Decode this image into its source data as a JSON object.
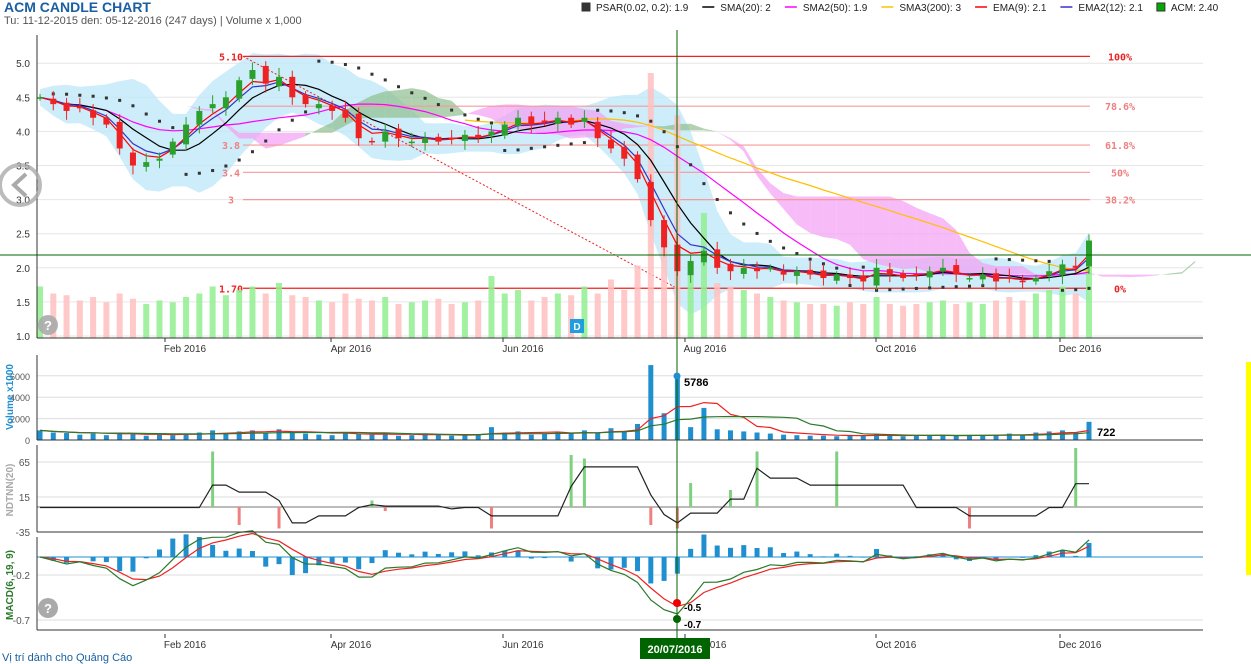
{
  "header": {
    "title": "ACM CANDLE CHART",
    "subtitle": "Tu: 11-12-2015 den: 05-12-2016 (247 days) | Volume x 1,000"
  },
  "legend": [
    {
      "label": "PSAR(0.02, 0.2): 1.9",
      "color": "#333333",
      "kind": "square"
    },
    {
      "label": "SMA(20): 2",
      "color": "#000000",
      "kind": "line"
    },
    {
      "label": "SMA2(50): 1.9",
      "color": "#ff00ff",
      "kind": "line"
    },
    {
      "label": "SMA3(200): 3",
      "color": "#ffc000",
      "kind": "line"
    },
    {
      "label": "EMA(9): 2.1",
      "color": "#ff0000",
      "kind": "line"
    },
    {
      "label": "EMA2(12): 2.1",
      "color": "#3333cc",
      "kind": "line"
    },
    {
      "label": "ACM: 2.40",
      "color": "#00aa00",
      "kind": "square"
    }
  ],
  "footer": "Vị trí dành cho Quảng Cáo",
  "crosshair": {
    "date": "20/07/2016",
    "volume_label": "5786",
    "macd_label": "-0.5",
    "signal_label": "-0.7",
    "vol_ma_label": "722"
  },
  "badge_d": "D",
  "colors": {
    "up": "#2ca02c",
    "down": "#ee2222",
    "vol_up": "#90ee90",
    "vol_down": "#ffc0c0",
    "volume": "#1f8fd0",
    "accent": "#1a5fa0"
  },
  "chart_data": {
    "type": "candlestick",
    "title": "ACM CANDLE CHART",
    "x_ticks": [
      "Feb 2016",
      "Apr 2016",
      "Jun 2016",
      "Aug 2016",
      "Oct 2016",
      "Dec 2016"
    ],
    "price_axis": {
      "ticks": [
        "1.0",
        "1.5",
        "2.0",
        "2.5",
        "3.0",
        "3.5",
        "4.0",
        "4.5",
        "5.0"
      ],
      "ylim": [
        1.0,
        5.4
      ]
    },
    "close": [
      4.5,
      4.4,
      4.3,
      4.35,
      4.2,
      4.1,
      3.75,
      3.5,
      3.55,
      3.6,
      3.85,
      4.1,
      4.3,
      4.4,
      4.5,
      4.75,
      4.9,
      4.7,
      4.8,
      4.5,
      4.4,
      4.4,
      4.3,
      4.2,
      3.9,
      3.85,
      4.0,
      3.9,
      3.85,
      3.9,
      3.85,
      3.9,
      3.95,
      3.9,
      4.0,
      4.1,
      4.2,
      4.1,
      4.15,
      4.2,
      4.1,
      4.2,
      3.9,
      3.75,
      3.6,
      3.3,
      2.7,
      2.3,
      1.95,
      2.1,
      2.25,
      2.0,
      1.95,
      2.0,
      1.95,
      2.0,
      1.9,
      1.95,
      1.9,
      1.85,
      1.9,
      1.85,
      1.8,
      2.0,
      1.9,
      1.85,
      1.9,
      1.95,
      2.0,
      1.9,
      1.85,
      1.9,
      1.8,
      1.85,
      1.8,
      1.85,
      1.95,
      2.05,
      2.0,
      2.4
    ],
    "volume": [
      900,
      700,
      650,
      500,
      600,
      450,
      700,
      550,
      400,
      500,
      450,
      600,
      700,
      900,
      650,
      800,
      900,
      700,
      1000,
      650,
      600,
      500,
      450,
      700,
      550,
      500,
      600,
      400,
      450,
      500,
      550,
      400,
      450,
      500,
      1200,
      700,
      800,
      500,
      600,
      700,
      650,
      900,
      700,
      1100,
      800,
      1500,
      7000,
      2500,
      5786,
      1200,
      3000,
      1000,
      900,
      800,
      700,
      600,
      500,
      450,
      400,
      400,
      350,
      450,
      400,
      600,
      400,
      350,
      400,
      450,
      500,
      400,
      450,
      400,
      500,
      600,
      500,
      700,
      800,
      900,
      700,
      1700
    ],
    "fibonacci": [
      {
        "label": "100%",
        "price": 5.1,
        "left_label": "5.10"
      },
      {
        "label": "78.6%",
        "price": 4.37,
        "left_label": ""
      },
      {
        "label": "61.8%",
        "price": 3.8,
        "left_label": "3.8"
      },
      {
        "label": "50%",
        "price": 3.4,
        "left_label": "3.4"
      },
      {
        "label": "38.2%",
        "price": 3.0,
        "left_label": "3"
      },
      {
        "label": "0%",
        "price": 1.7,
        "left_label": "1.70"
      }
    ],
    "volume_panel": {
      "label": "Volume x1000",
      "ticks": [
        "0",
        "2000",
        "4000",
        "6000"
      ]
    },
    "ndtnn_panel": {
      "label": "NDTNN(20)",
      "ticks": [
        "-35",
        "15",
        "65"
      ],
      "bars": {
        "13": 80,
        "15": -25,
        "18": -30,
        "25": 10,
        "26": -5,
        "34": -30,
        "40": 75,
        "41": 70,
        "46": -25,
        "48": -30,
        "49": 35,
        "52": 25,
        "54": 80,
        "60": 80,
        "70": -30,
        "78": 85
      }
    },
    "macd_panel": {
      "label": "MACD(6, 19, 9)",
      "ticks": [
        "-0.2",
        "-0.7"
      ]
    }
  }
}
